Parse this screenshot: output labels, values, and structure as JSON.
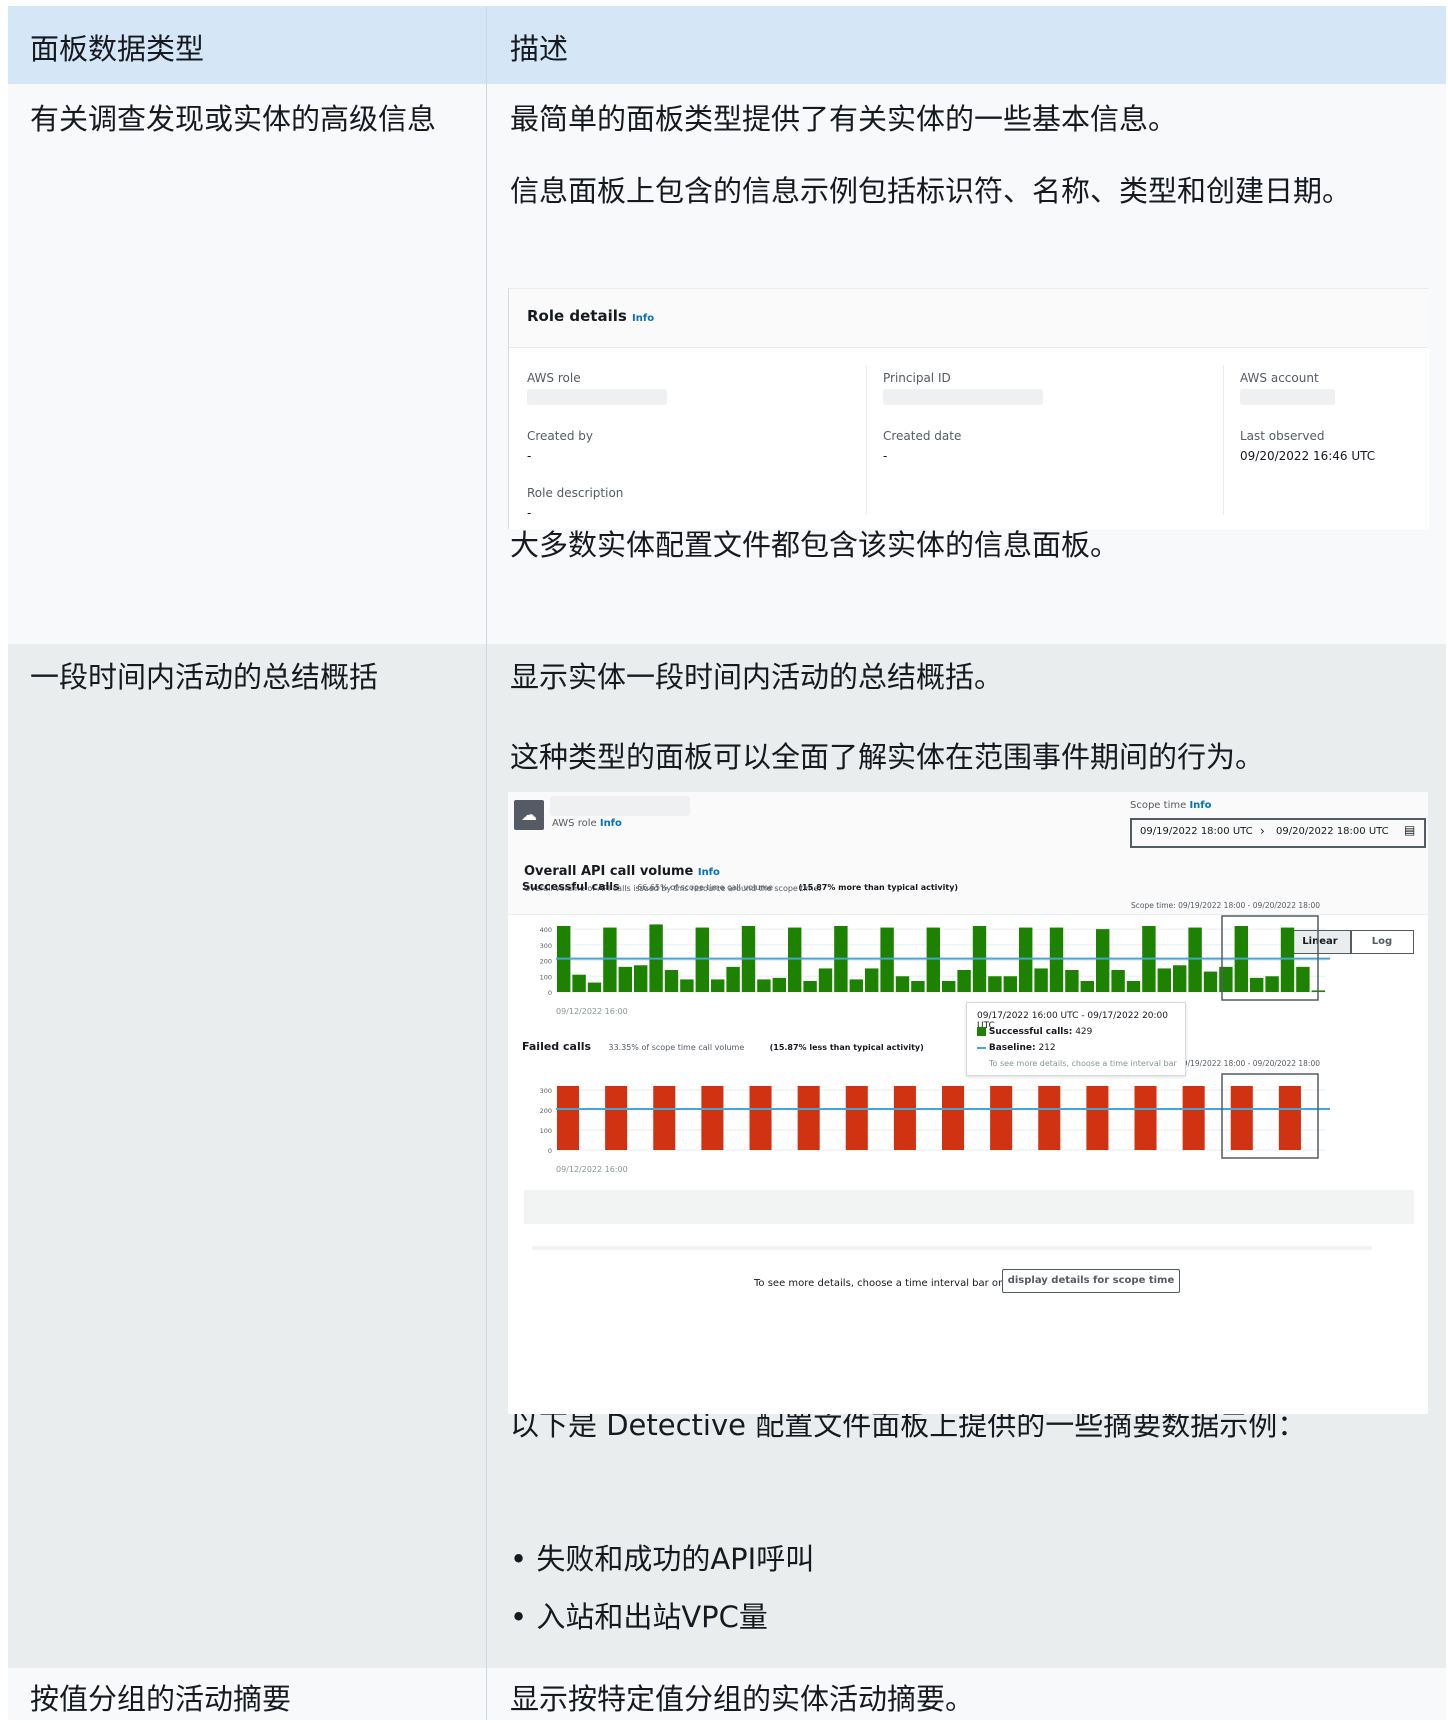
{
  "header": {
    "col1": "面板数据类型",
    "col2": "描述"
  },
  "row1": {
    "left": "有关调查发现或实体的高级信息",
    "p1": "最简单的面板类型提供了有关实体的一些基本信息。",
    "p2": "信息面板上包含的信息示例包括标识符、名称、类型和创建日期。",
    "p3": "大多数实体配置文件都包含该实体的信息面板。",
    "panel": {
      "title": "Role details",
      "info": "Info",
      "aws_role": "AWS role",
      "principal_id": "Principal ID",
      "aws_account": "AWS account",
      "created_by": "Created by",
      "created_by_val": "-",
      "created_date": "Created date",
      "created_date_val": "-",
      "last_observed": "Last observed",
      "last_observed_val": "09/20/2022 16:46 UTC",
      "role_description": "Role description",
      "role_description_val": "-"
    }
  },
  "row2": {
    "left": "一段时间内活动的总结概括",
    "p1": "显示实体一段时间内活动的总结概括。",
    "p2": "这种类型的面板可以全面了解实体在范围事件期间的行为。",
    "p3": "以下是 Detective 配置文件面板上提供的一些摘要数据示例：",
    "bullets": [
      "失败和成功的API呼叫",
      "入站和出站VPC量"
    ],
    "chart_panel": {
      "aws_role": "AWS role",
      "info": "Info",
      "scope_time_label": "Scope time",
      "scope_start": "09/19/2022 18:00 UTC",
      "scope_end": "09/20/2022 18:00 UTC",
      "title": "Overall API call volume",
      "subtitle": "Overall volume of API calls issued by this resource around the scope time.",
      "linear": "Linear",
      "log": "Log",
      "footer_text": "To see more details, choose a time interval bar or",
      "footer_button": "display details for scope time",
      "tooltip": {
        "range": "09/17/2022 16:00 UTC - 09/17/2022 20:00 UTC",
        "successful_label": "Successful calls:",
        "successful_val": "429",
        "baseline_label": "Baseline:",
        "baseline_val": "212",
        "hint": "To see more details, choose a time interval bar"
      }
    }
  },
  "row3": {
    "left": "按值分组的活动摘要",
    "p1": "显示按特定值分组的实体活动摘要。"
  },
  "colors": {
    "success": "#1d8102",
    "failed": "#d13212",
    "baseline": "#44a5d6"
  },
  "chart_data": [
    {
      "type": "bar",
      "title": "Successful calls",
      "subtitle": "66.65% of scope time call volume",
      "note": "(15.87% more than typical activity)",
      "scope_label": "Scope time: 09/19/2022 18:00 - 09/20/2022 18:00",
      "x_tick": "09/12/2022 16:00",
      "y_ticks": [
        0,
        100,
        200,
        300,
        400
      ],
      "ylim": [
        0,
        420
      ],
      "baseline": 212,
      "values": [
        420,
        110,
        60,
        410,
        160,
        170,
        430,
        140,
        80,
        410,
        80,
        160,
        420,
        80,
        90,
        410,
        70,
        150,
        420,
        80,
        150,
        410,
        100,
        70,
        410,
        70,
        140,
        420,
        100,
        100,
        410,
        150,
        410,
        140,
        70,
        400,
        140,
        70,
        420,
        150,
        170,
        410,
        130,
        160,
        420,
        90,
        100,
        410,
        160,
        10
      ]
    },
    {
      "type": "bar",
      "title": "Failed calls",
      "subtitle": "33.35% of scope time call volume",
      "note": "(15.87% less than typical activity)",
      "scope_label": "Scope time: 09/19/2022 18:00 - 09/20/2022 18:00",
      "x_tick": "09/12/2022 16:00",
      "y_ticks": [
        0,
        100,
        200,
        300
      ],
      "ylim": [
        0,
        330
      ],
      "baseline": 205,
      "values": [
        320,
        0,
        320,
        0,
        320,
        0,
        320,
        0,
        320,
        0,
        320,
        0,
        320,
        0,
        320,
        0,
        320,
        0,
        320,
        0,
        320,
        0,
        320,
        0,
        320,
        0,
        320,
        0,
        320,
        0,
        320,
        0
      ]
    }
  ]
}
